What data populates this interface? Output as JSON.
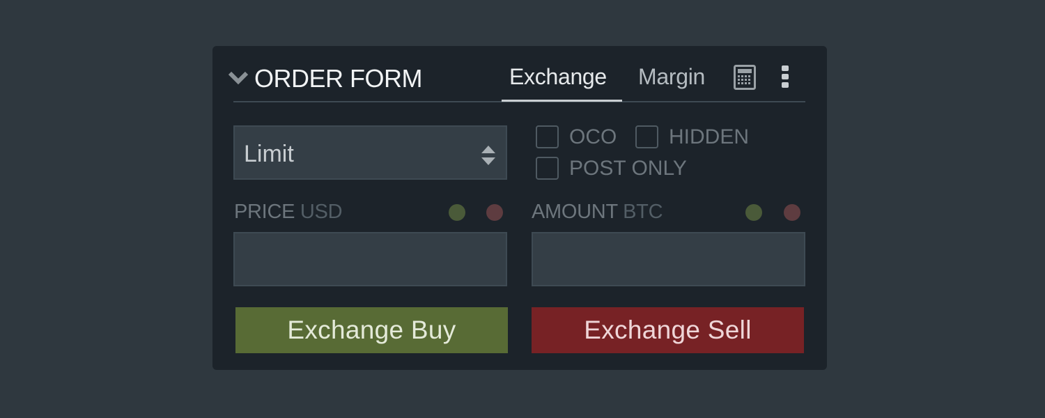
{
  "header": {
    "title": "ORDER FORM",
    "tabs": [
      {
        "label": "Exchange",
        "active": true
      },
      {
        "label": "Margin",
        "active": false
      }
    ]
  },
  "icons": {
    "collapse": "chevron-down-icon",
    "calculator": "calculator-icon",
    "more": "vertical-dots-icon"
  },
  "order_type": {
    "selected": "Limit"
  },
  "options": [
    {
      "label": "OCO",
      "checked": false
    },
    {
      "label": "HIDDEN",
      "checked": false
    },
    {
      "label": "POST ONLY",
      "checked": false
    }
  ],
  "price": {
    "label": "PRICE",
    "unit": "USD",
    "value": ""
  },
  "amount": {
    "label": "AMOUNT",
    "unit": "BTC",
    "value": ""
  },
  "buttons": {
    "buy": "Exchange Buy",
    "sell": "Exchange Sell"
  },
  "colors": {
    "buy": "#586b35",
    "sell": "#772225",
    "dot_green": "#4a5a39",
    "dot_red": "#5e3c40"
  }
}
